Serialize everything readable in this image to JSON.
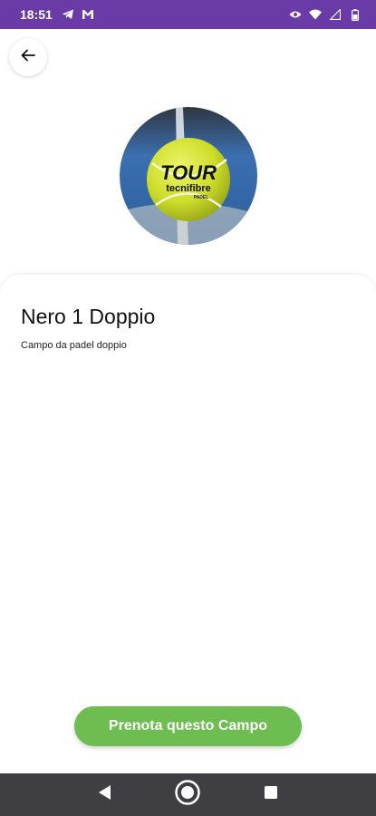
{
  "status_bar": {
    "time": "18:51",
    "left_icons": [
      "telegram-icon",
      "gmail-icon"
    ],
    "right_icons": [
      "eye-icon",
      "wifi-icon",
      "signal-icon",
      "battery-icon"
    ]
  },
  "header": {
    "back_icon": "arrow-left-icon"
  },
  "court": {
    "name": "Nero 1 Doppio",
    "description": "Campo da padel doppio",
    "image_logo_text": [
      "TOUR",
      "tecnifibre",
      "PADEL"
    ]
  },
  "actions": {
    "book_label": "Prenota questo Campo"
  },
  "colors": {
    "status_bar": "#6a3aa6",
    "accent_green": "#6dbd51",
    "nav_bar": "#3f3f43"
  },
  "nav": {
    "buttons": [
      "back-triangle-icon",
      "home-circle-icon",
      "recents-square-icon"
    ]
  }
}
